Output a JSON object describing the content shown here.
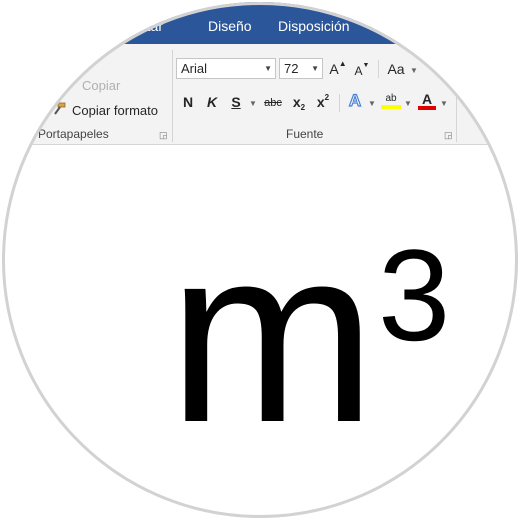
{
  "tabs": [
    "rtar",
    "Diseño",
    "Disposición"
  ],
  "clipboard": {
    "copy_label": "Copiar",
    "format_painter_label": "Copiar formato",
    "group_label": "Portapapeles"
  },
  "font": {
    "font_name": "Arial",
    "font_size": "72",
    "grow_label": "A",
    "shrink_label": "A",
    "change_case_label": "Aa",
    "bold_label": "N",
    "italic_label": "K",
    "underline_label": "S",
    "strike_label": "abc",
    "subscript_label": "x",
    "subscript_mark": "2",
    "superscript_label": "x",
    "superscript_mark": "2",
    "text_effects_label": "A",
    "highlight_label": "ab",
    "font_color_label": "A",
    "group_label": "Fuente"
  },
  "document": {
    "base_text": "m",
    "superscript_text": "3"
  },
  "colors": {
    "title_bar": "#2b579a",
    "highlight": "#ffff00",
    "font_color": "#e00000",
    "text_effects": "#4a7fd4"
  }
}
